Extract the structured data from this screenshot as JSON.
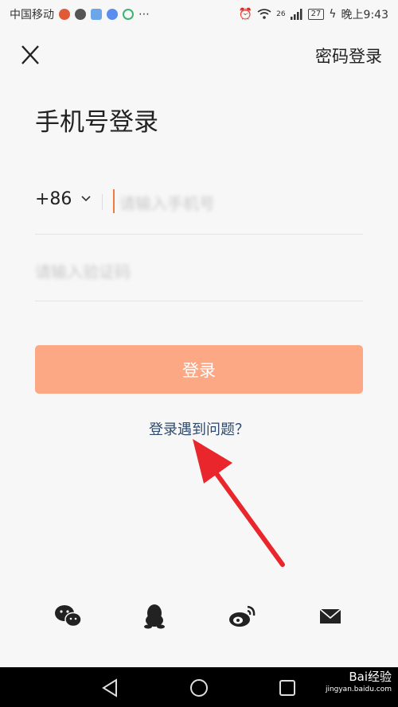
{
  "status_bar": {
    "carrier": "中国移动",
    "network": "26",
    "battery": "27",
    "time": "晚上9:43"
  },
  "header": {
    "password_login": "密码登录"
  },
  "title": "手机号登录",
  "phone": {
    "country_code": "+86",
    "placeholder": "请输入手机号"
  },
  "code": {
    "placeholder": "请输入验证码"
  },
  "login_button": "登录",
  "problem_link": "登录遇到问题？",
  "social": [
    "wechat-icon",
    "qq-icon",
    "weibo-icon",
    "email-icon"
  ],
  "colors": {
    "accent": "#fca884",
    "cursor": "#f07b3f",
    "link": "#2f4a6b",
    "arrow": "#e8262b"
  },
  "watermark": {
    "brand": "Bai经验",
    "url": "jingyan.baidu.com"
  }
}
